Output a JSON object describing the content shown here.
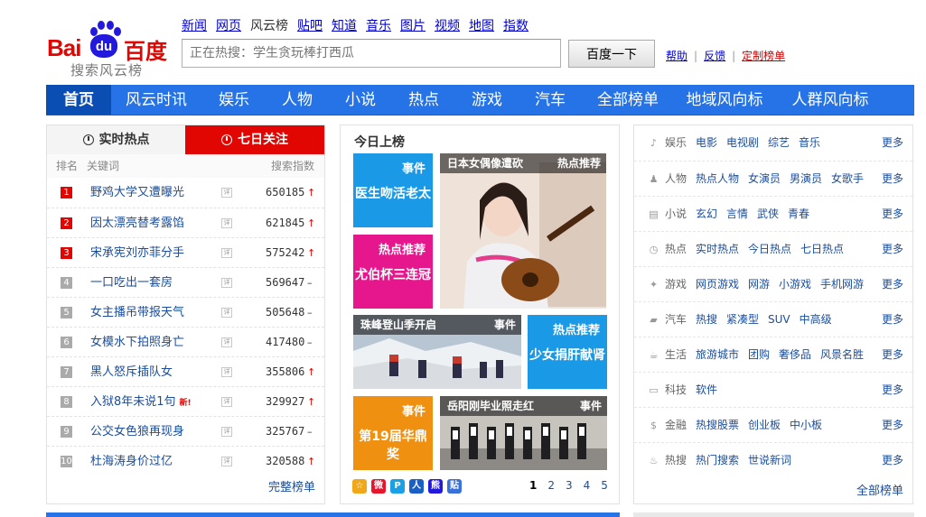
{
  "logo": {
    "brand_en": "Bai",
    "brand_mid": "du",
    "brand_cn": "百度",
    "subtitle": "搜索风云榜"
  },
  "topnav": [
    "新闻",
    "网页",
    "风云榜",
    "贴吧",
    "知道",
    "音乐",
    "图片",
    "视频",
    "地图",
    "指数"
  ],
  "search": {
    "placeholder": "正在热搜：学生贪玩棒打西瓜",
    "button": "百度一下"
  },
  "toplinks": {
    "help": "帮助",
    "feedback": "反馈",
    "custom": "定制榜单"
  },
  "mainnav": [
    "首页",
    "风云时讯",
    "娱乐",
    "人物",
    "小说",
    "热点",
    "游戏",
    "汽车",
    "全部榜单",
    "地域风向标",
    "人群风向标"
  ],
  "hot": {
    "tab_realtime": "实时热点",
    "tab_week": "七日关注",
    "col_rank": "排名",
    "col_keyword": "关键词",
    "col_index": "搜索指数",
    "detail_icon": "详",
    "rows": [
      {
        "rank": "1",
        "kw": "野鸡大学又遭曝光",
        "val": "650185",
        "trend": "↑",
        "new": ""
      },
      {
        "rank": "2",
        "kw": "因太漂亮替考露馅",
        "val": "621845",
        "trend": "↑",
        "new": ""
      },
      {
        "rank": "3",
        "kw": "宋承宪刘亦菲分手",
        "val": "575242",
        "trend": "↑",
        "new": ""
      },
      {
        "rank": "4",
        "kw": "一口吃出一套房",
        "val": "569647",
        "trend": "–",
        "new": ""
      },
      {
        "rank": "5",
        "kw": "女主播吊带报天气",
        "val": "505648",
        "trend": "–",
        "new": ""
      },
      {
        "rank": "6",
        "kw": "女模水下拍照身亡",
        "val": "417480",
        "trend": "–",
        "new": ""
      },
      {
        "rank": "7",
        "kw": "黑人怒斥插队女",
        "val": "355806",
        "trend": "↑",
        "new": ""
      },
      {
        "rank": "8",
        "kw": "入狱8年未说1句",
        "val": "329927",
        "trend": "↑",
        "new": "新!"
      },
      {
        "rank": "9",
        "kw": "公交女色狼再现身",
        "val": "325767",
        "trend": "–",
        "new": ""
      },
      {
        "rank": "10",
        "kw": "杜海涛身价过亿",
        "val": "320588",
        "trend": "↑",
        "new": ""
      }
    ],
    "more": "完整榜单"
  },
  "today": {
    "title": "今日上榜",
    "t1_tag": "事件",
    "t1_text": "医生吻活老太",
    "t2_cap": "日本女偶像遭砍",
    "t2_tag": "热点推荐",
    "t3_tag": "热点推荐",
    "t3_text": "尤伯杯三连冠",
    "t4_cap": "珠峰登山季开启",
    "t4_tag": "事件",
    "t5_tag": "热点推荐",
    "t5_text": "少女捐肝献肾",
    "t6_tag": "事件",
    "t6_text": "第19届华鼎奖",
    "t7_cap": "岳阳刚毕业照走红",
    "t7_tag": "事件",
    "icons": [
      "☆",
      "微",
      "P",
      "人",
      "熊",
      "贴"
    ],
    "pages": [
      "1",
      "2",
      "3",
      "4",
      "5"
    ]
  },
  "categories": {
    "more": "更多",
    "items": [
      {
        "icon": "♪",
        "name": "娱乐",
        "links": [
          "电影",
          "电视剧",
          "综艺",
          "音乐"
        ]
      },
      {
        "icon": "♟",
        "name": "人物",
        "links": [
          "热点人物",
          "女演员",
          "男演员",
          "女歌手"
        ]
      },
      {
        "icon": "▤",
        "name": "小说",
        "links": [
          "玄幻",
          "言情",
          "武侠",
          "青春"
        ]
      },
      {
        "icon": "◷",
        "name": "热点",
        "links": [
          "实时热点",
          "今日热点",
          "七日热点"
        ]
      },
      {
        "icon": "✦",
        "name": "游戏",
        "links": [
          "网页游戏",
          "网游",
          "小游戏",
          "手机网游"
        ]
      },
      {
        "icon": "▰",
        "name": "汽车",
        "links": [
          "热搜",
          "紧凑型",
          "SUV",
          "中高级"
        ]
      },
      {
        "icon": "☕",
        "name": "生活",
        "links": [
          "旅游城市",
          "团购",
          "奢侈品",
          "风景名胜"
        ]
      },
      {
        "icon": "▭",
        "name": "科技",
        "links": [
          "软件"
        ]
      },
      {
        "icon": "$",
        "name": "金融",
        "links": [
          "热搜股票",
          "创业板",
          "中小板"
        ]
      },
      {
        "icon": "♨",
        "name": "热搜",
        "links": [
          "热门搜索",
          "世说新词"
        ]
      }
    ],
    "all": "全部榜单"
  }
}
